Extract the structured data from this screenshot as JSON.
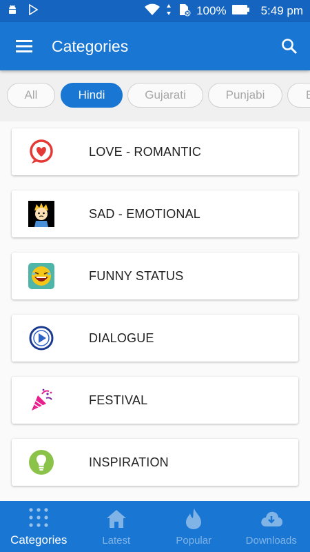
{
  "status_bar": {
    "battery_percent": "100%",
    "time": "5:49 pm",
    "icons": [
      "android-icon",
      "play-store-icon",
      "wifi-icon",
      "sd-card-icon",
      "battery-icon"
    ]
  },
  "app_bar": {
    "title": "Categories",
    "menu_icon": "hamburger-menu-icon",
    "search_icon": "search-icon"
  },
  "chips": [
    {
      "label": "All",
      "active": false
    },
    {
      "label": "Hindi",
      "active": true
    },
    {
      "label": "Gujarati",
      "active": false
    },
    {
      "label": "Punjabi",
      "active": false
    },
    {
      "label": "E",
      "active": false
    }
  ],
  "categories": [
    {
      "label": "LOVE - ROMANTIC",
      "icon": "heart-chat-icon"
    },
    {
      "label": "SAD - EMOTIONAL",
      "icon": "sad-boy-icon"
    },
    {
      "label": "FUNNY STATUS",
      "icon": "laughing-face-icon"
    },
    {
      "label": "DIALOGUE",
      "icon": "play-circle-icon"
    },
    {
      "label": "FESTIVAL",
      "icon": "party-popper-icon"
    },
    {
      "label": "INSPIRATION",
      "icon": "lightbulb-icon"
    }
  ],
  "bottom_nav": [
    {
      "label": "Categories",
      "icon": "grid-dots-icon",
      "active": true
    },
    {
      "label": "Latest",
      "icon": "home-icon",
      "active": false
    },
    {
      "label": "Popular",
      "icon": "flame-icon",
      "active": false
    },
    {
      "label": "Downloads",
      "icon": "cloud-download-icon",
      "active": false
    }
  ],
  "colors": {
    "primary": "#1976d2",
    "status_bar": "#1565c0",
    "chip_border": "#cfcfcf"
  }
}
